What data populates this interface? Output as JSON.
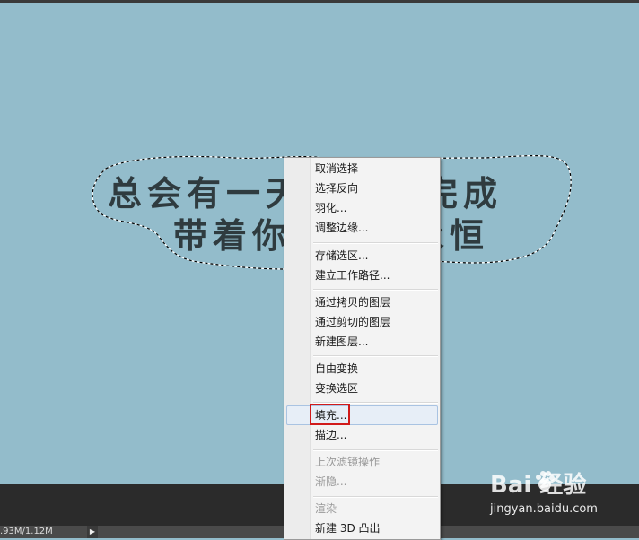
{
  "canvas": {
    "line1": "总会有一天梦想会完成",
    "line2": "带着你的梦想永恒"
  },
  "menu": {
    "items": [
      {
        "label": "取消选择",
        "enabled": true
      },
      {
        "label": "选择反向",
        "enabled": true
      },
      {
        "label": "羽化...",
        "enabled": true
      },
      {
        "label": "调整边缘...",
        "enabled": true
      },
      {
        "label": "存储选区...",
        "enabled": true
      },
      {
        "label": "建立工作路径...",
        "enabled": true
      },
      {
        "label": "通过拷贝的图层",
        "enabled": true
      },
      {
        "label": "通过剪切的图层",
        "enabled": true
      },
      {
        "label": "新建图层...",
        "enabled": true
      },
      {
        "label": "自由变换",
        "enabled": true
      },
      {
        "label": "变换选区",
        "enabled": true
      },
      {
        "label": "填充...",
        "enabled": true,
        "highlighted": true
      },
      {
        "label": "描边...",
        "enabled": true
      },
      {
        "label": "上次滤镜操作",
        "enabled": false
      },
      {
        "label": "渐隐...",
        "enabled": false
      },
      {
        "label": "渲染",
        "enabled": false
      },
      {
        "label": "新建 3D 凸出",
        "enabled": true
      }
    ]
  },
  "status": {
    "doc_size": ".93M/1.12M",
    "arrow": "▶"
  },
  "watermark": {
    "logo": "Bai  经验",
    "url": "jingyan.baidu.com"
  },
  "colors": {
    "canvas_bg": "#93bccb",
    "highlight_border": "#d11a1a"
  }
}
